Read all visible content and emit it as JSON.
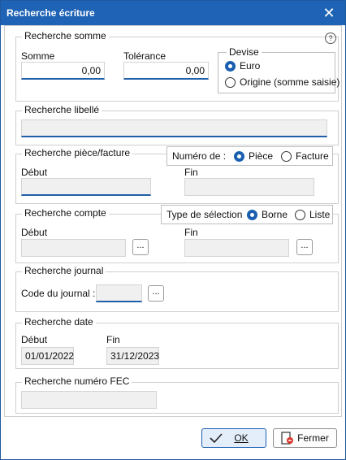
{
  "window": {
    "title": "Recherche écriture"
  },
  "sections": {
    "somme": {
      "legend": "Recherche somme",
      "somme_label": "Somme",
      "somme_value": "0,00",
      "tolerance_label": "Tolérance",
      "tolerance_value": "0,00",
      "devise": {
        "legend": "Devise",
        "options": [
          "Euro",
          "Origine (somme saisie)"
        ],
        "selected": "Euro"
      }
    },
    "libelle": {
      "legend": "Recherche libellé",
      "value": ""
    },
    "piece": {
      "legend": "Recherche pièce/facture",
      "numero_label": "Numéro de :",
      "options": [
        "Pièce",
        "Facture"
      ],
      "selected": "Pièce",
      "debut_label": "Début",
      "fin_label": "Fin",
      "debut_value": "",
      "fin_value": ""
    },
    "compte": {
      "legend": "Recherche compte",
      "type_label": "Type de sélection",
      "options": [
        "Borne",
        "Liste"
      ],
      "selected": "Borne",
      "debut_label": "Début",
      "fin_label": "Fin",
      "browse_label": "..."
    },
    "journal": {
      "legend": "Recherche journal",
      "code_label": "Code du journal :",
      "browse_label": "..."
    },
    "date": {
      "legend": "Recherche date",
      "debut_label": "Début",
      "debut_value": "01/01/2022",
      "fin_label": "Fin",
      "fin_value": "31/12/2023"
    },
    "fec": {
      "legend": "Recherche numéro FEC",
      "value": ""
    }
  },
  "buttons": {
    "ok": "OK",
    "fermer": "Fermer"
  },
  "colors": {
    "titlebar": "#1e63b5",
    "accent": "#1a5fb0"
  }
}
